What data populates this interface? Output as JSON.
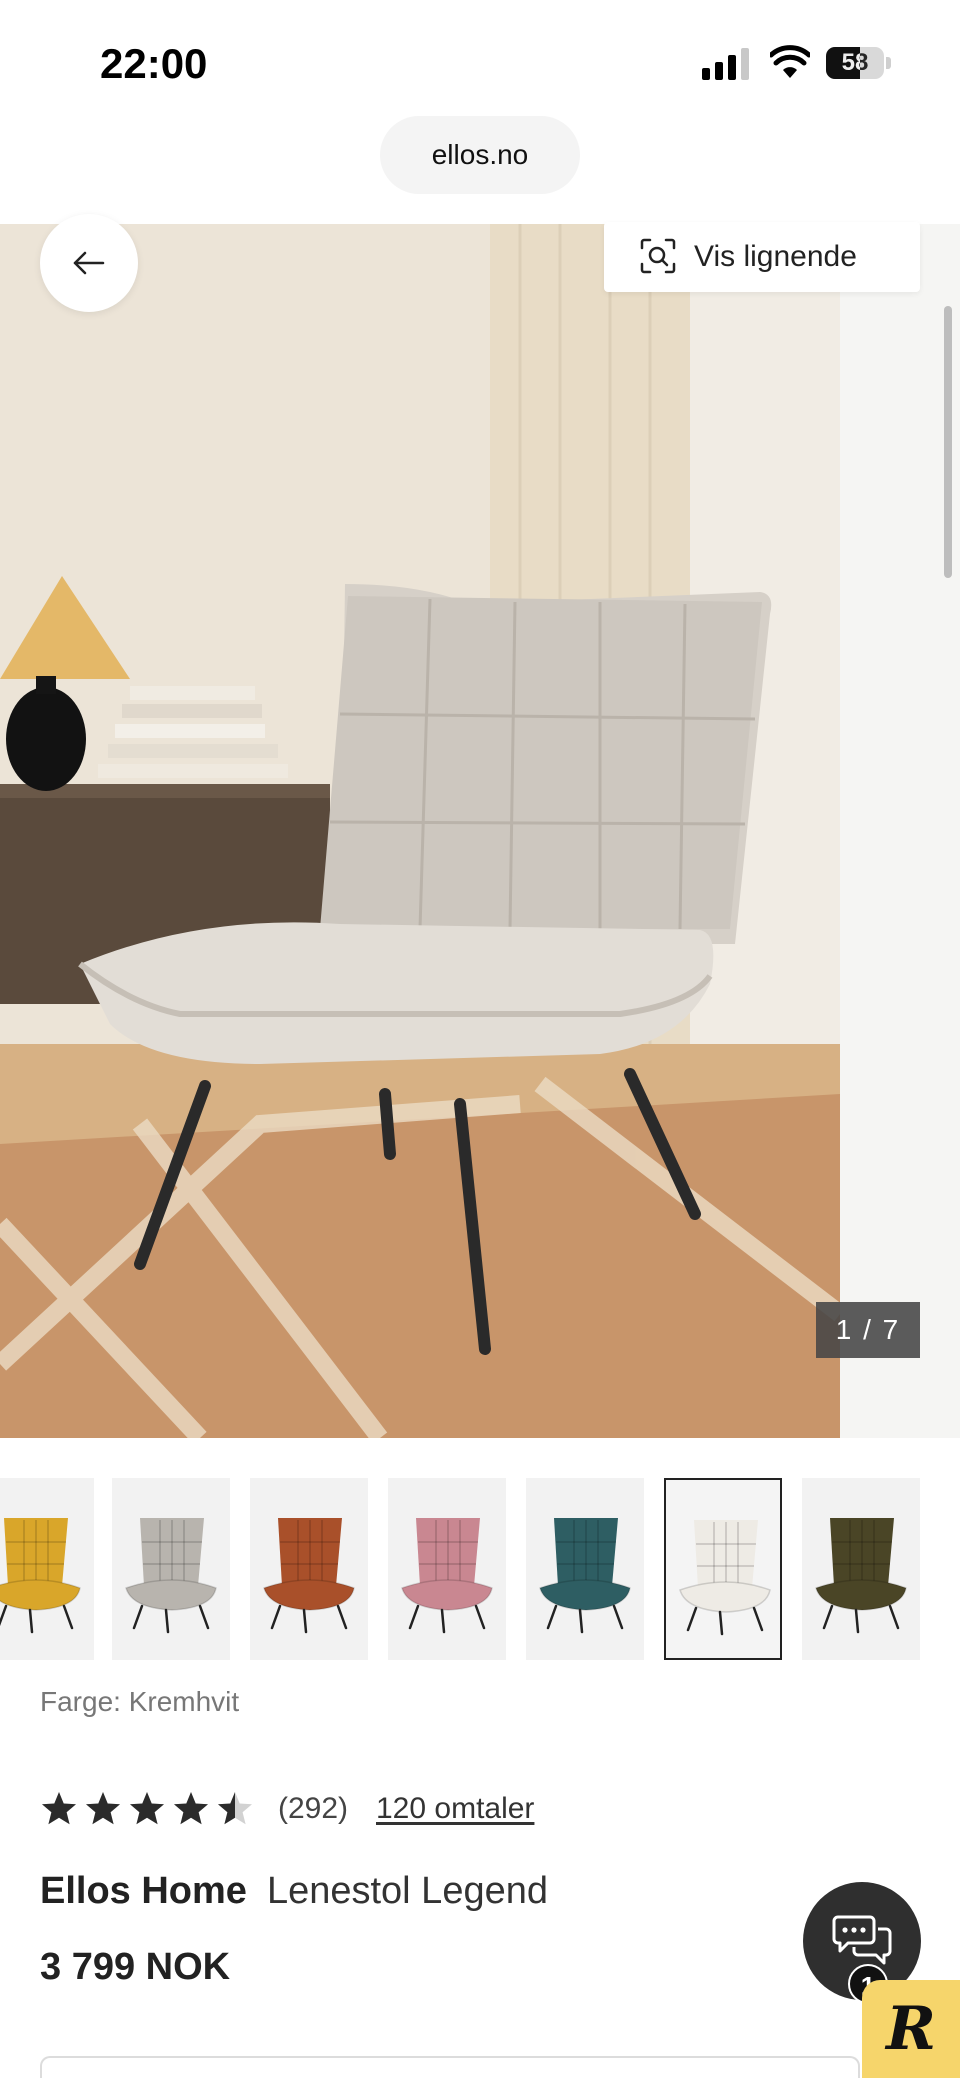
{
  "status_bar": {
    "time": "22:00",
    "battery_percent": "58",
    "battery_level": 0.58,
    "signal_bars": 3,
    "signal_max": 4
  },
  "browser": {
    "url": "ellos.no"
  },
  "gallery": {
    "back_icon": "arrow-left-icon",
    "similar_icon": "visual-search-icon",
    "similar_label": "Vis lignende",
    "counter": "1 / 7"
  },
  "swatches": [
    {
      "color": "#d9a62a",
      "selected": false
    },
    {
      "color": "#b8b4ae",
      "selected": false
    },
    {
      "color": "#a9502a",
      "selected": false
    },
    {
      "color": "#c98791",
      "selected": false
    },
    {
      "color": "#2e5e63",
      "selected": false
    },
    {
      "color": "#eeebe5",
      "selected": true
    },
    {
      "color": "#4a4526",
      "selected": false
    }
  ],
  "product": {
    "color_label": "Farge: Kremhvit",
    "rating": 4.5,
    "rating_max": 5,
    "rating_count": "(292)",
    "reviews_link": "120 omtaler",
    "brand": "Ellos Home",
    "name": "Lenestol Legend",
    "price": "3 799 NOK"
  },
  "chat": {
    "icon": "chat-bubbles-icon",
    "badge": "1",
    "logo_letter": "R"
  },
  "colors": {
    "accent_dark": "#2f2f2f",
    "logo_yellow": "#f6d56b",
    "text": "#222222"
  }
}
